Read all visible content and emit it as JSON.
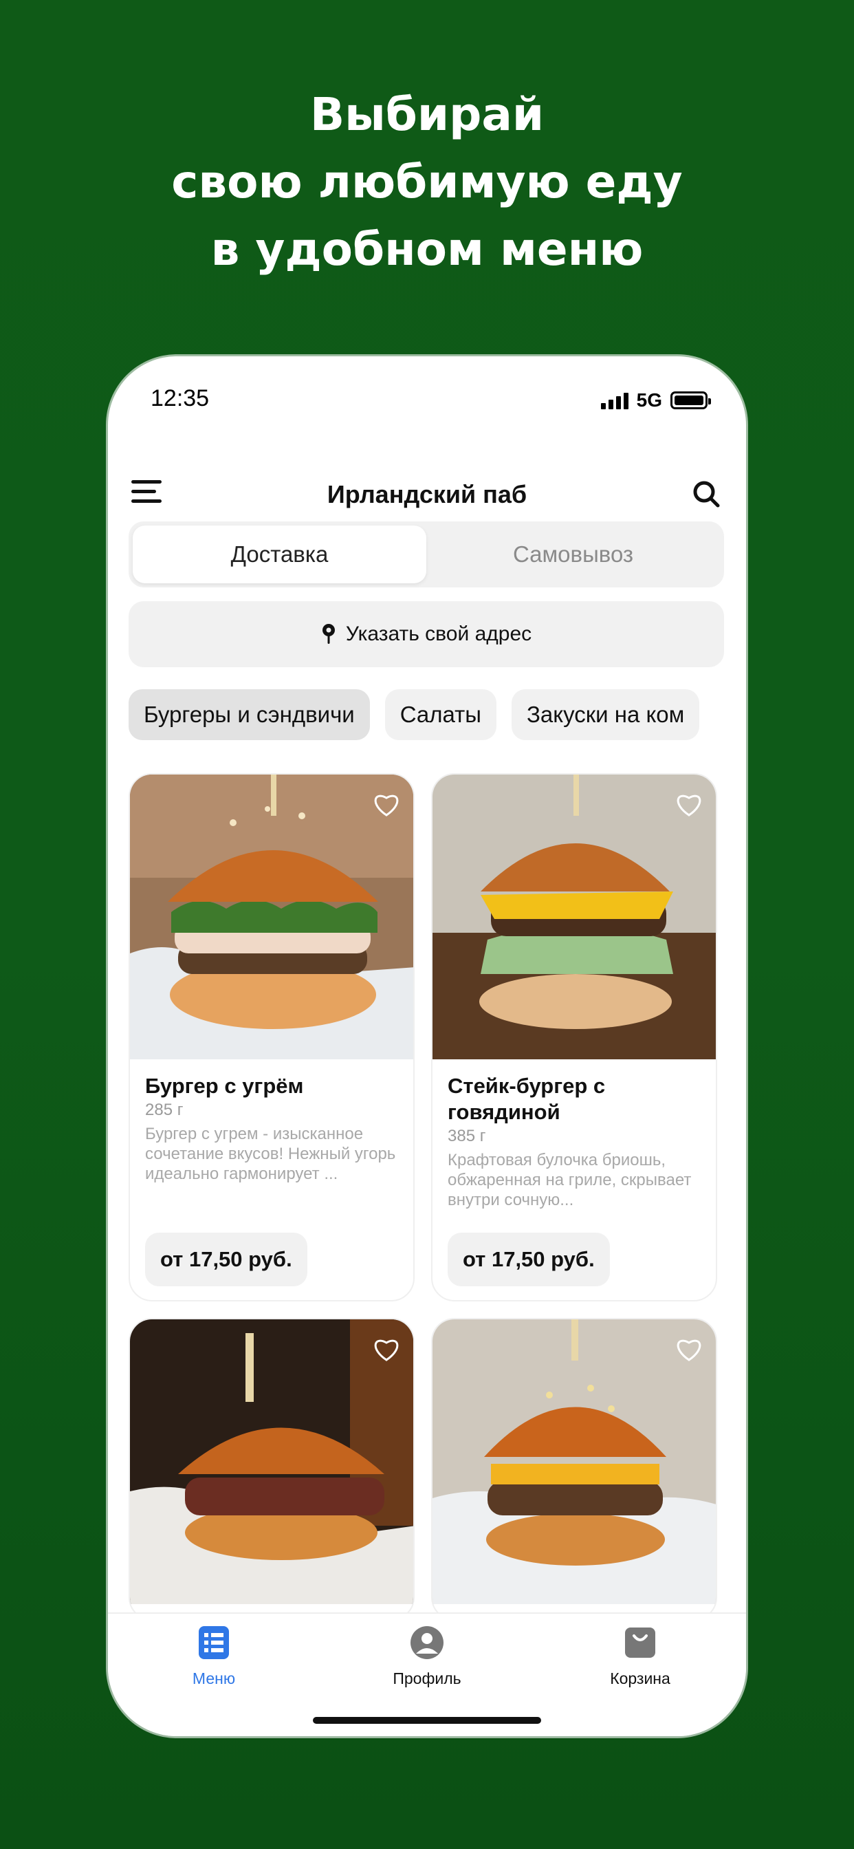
{
  "promo": {
    "line1": "Выбирай",
    "line2": "свою любимую еду",
    "line3": "в удобном меню"
  },
  "status": {
    "time": "12:35",
    "network": "5G"
  },
  "header": {
    "title": "Ирландский паб"
  },
  "delivery_toggle": {
    "options": [
      "Доставка",
      "Самовывоз"
    ],
    "selected": "Доставка"
  },
  "address": {
    "label": "Указать свой адрес"
  },
  "categories": [
    {
      "label": "Бургеры и сэндвичи",
      "active": true
    },
    {
      "label": "Салаты",
      "active": false
    },
    {
      "label": "Закуски на ком",
      "active": false
    }
  ],
  "products": [
    {
      "name": "Бургер с угрём",
      "weight": "285 г",
      "description": "Бургер с угрем - изысканное сочетание вкусов! Нежный угорь идеально гармонирует ...",
      "price": "от 17,50 руб."
    },
    {
      "name": "Стейк-бургер с говядиной",
      "weight": "385 г",
      "description": "Крафтовая булочка бриошь, обжаренная на гриле, скрывает внутри сочную...",
      "price": "от 17,50 руб."
    }
  ],
  "tabbar": {
    "menu": "Меню",
    "profile": "Профиль",
    "cart": "Корзина"
  },
  "colors": {
    "background": "#0e5a18",
    "accent": "#2f77e6"
  }
}
